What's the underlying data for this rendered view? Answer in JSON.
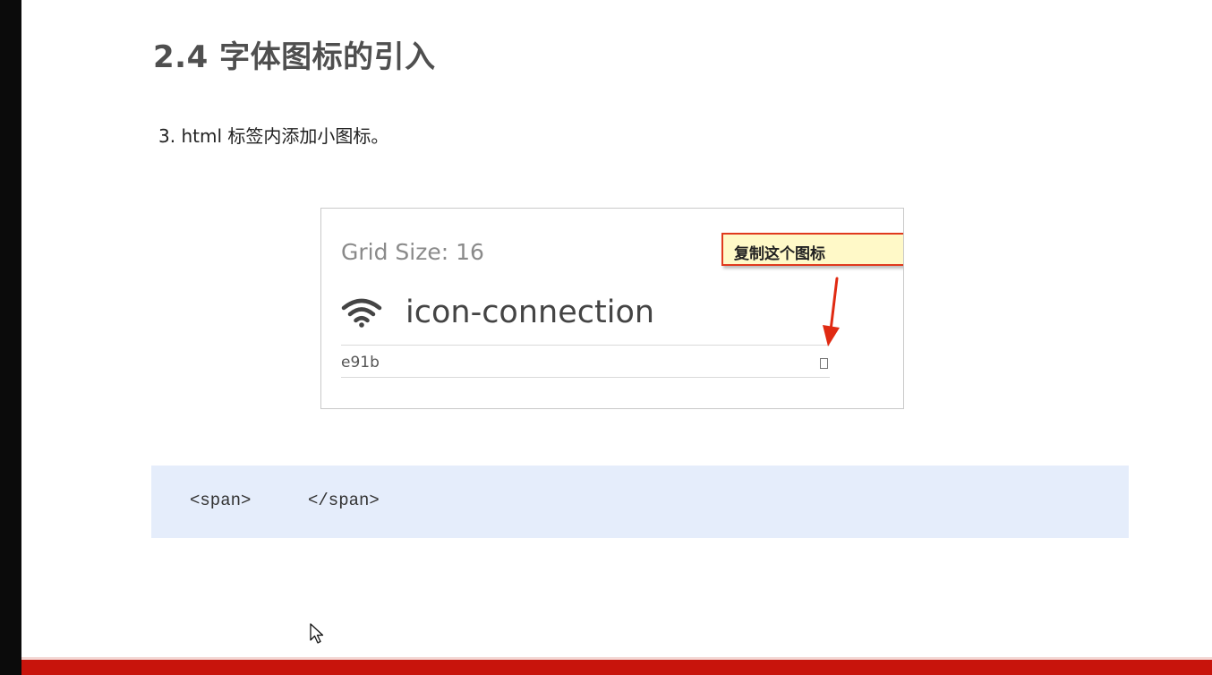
{
  "slide": {
    "title": "2.4 字体图标的引入",
    "step": "3. html 标签内添加小图标。"
  },
  "icon_card": {
    "grid_size": "Grid Size: 16",
    "icon_name": "icon-connection",
    "icon": "wifi-icon",
    "unicode": "e91b",
    "callout": "复制这个图标"
  },
  "code": {
    "open_tag": "<span>",
    "close_tag": "</span>"
  },
  "colors": {
    "accent_red": "#c8140c",
    "code_bg": "#e5edfb",
    "callout_bg": "#fff9c8",
    "callout_border": "#e03a1e"
  }
}
